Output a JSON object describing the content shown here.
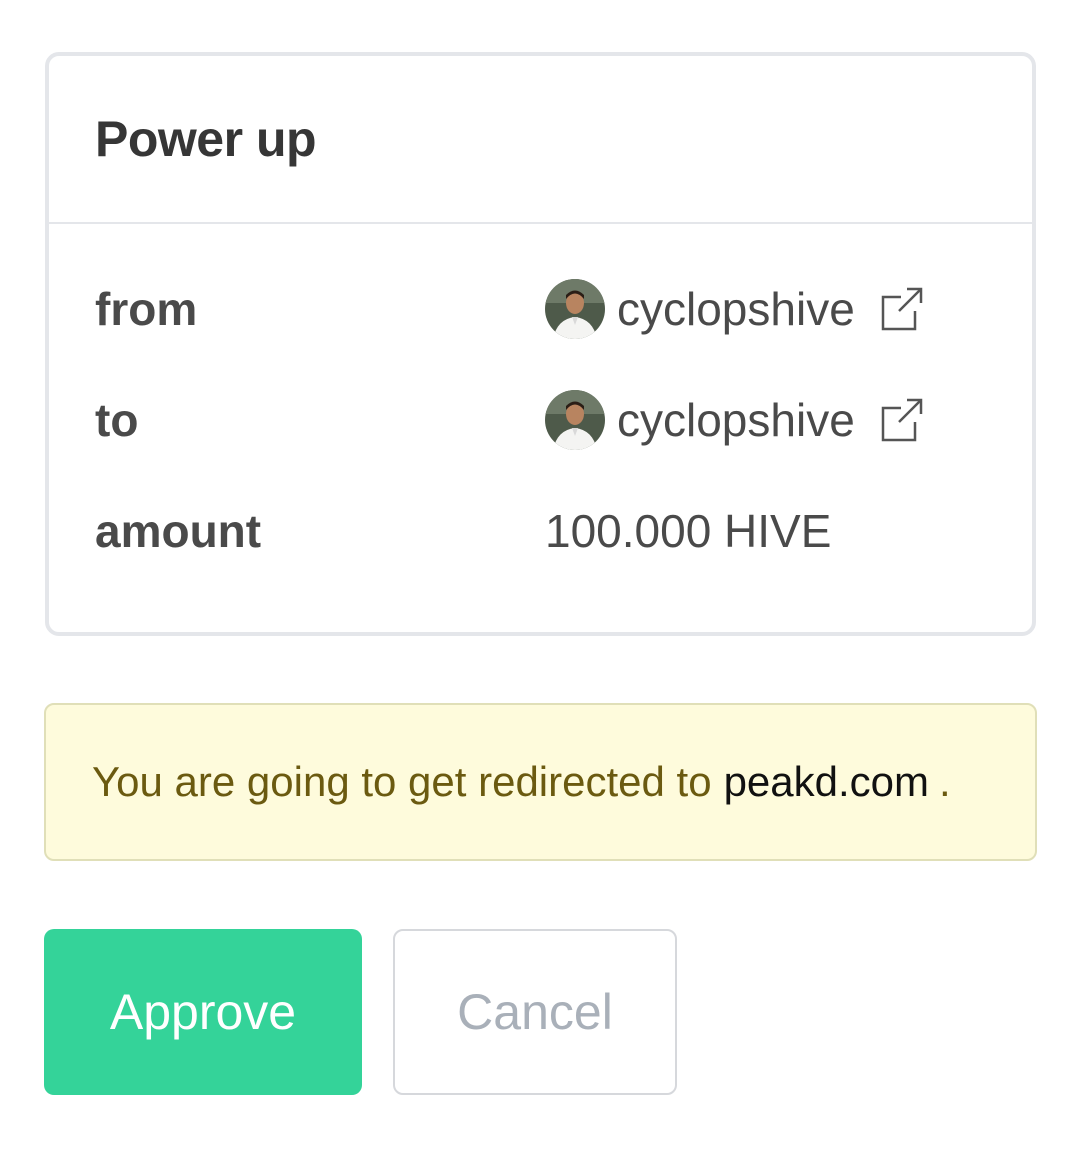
{
  "operation": {
    "title": "Power up",
    "rows": [
      {
        "label": "from",
        "account": "cyclopshive",
        "icon": "external-link-icon"
      },
      {
        "label": "to",
        "account": "cyclopshive",
        "icon": "external-link-icon"
      },
      {
        "label": "amount",
        "value": "100.000 HIVE"
      }
    ]
  },
  "notice": {
    "text": "You are going to get redirected to",
    "domain": "peakd.com",
    "suffix": "."
  },
  "buttons": {
    "approve": "Approve",
    "cancel": "Cancel"
  },
  "colors": {
    "approve_bg": "#34d399",
    "notice_bg": "#fefbdc",
    "notice_text": "#6b5a10"
  }
}
